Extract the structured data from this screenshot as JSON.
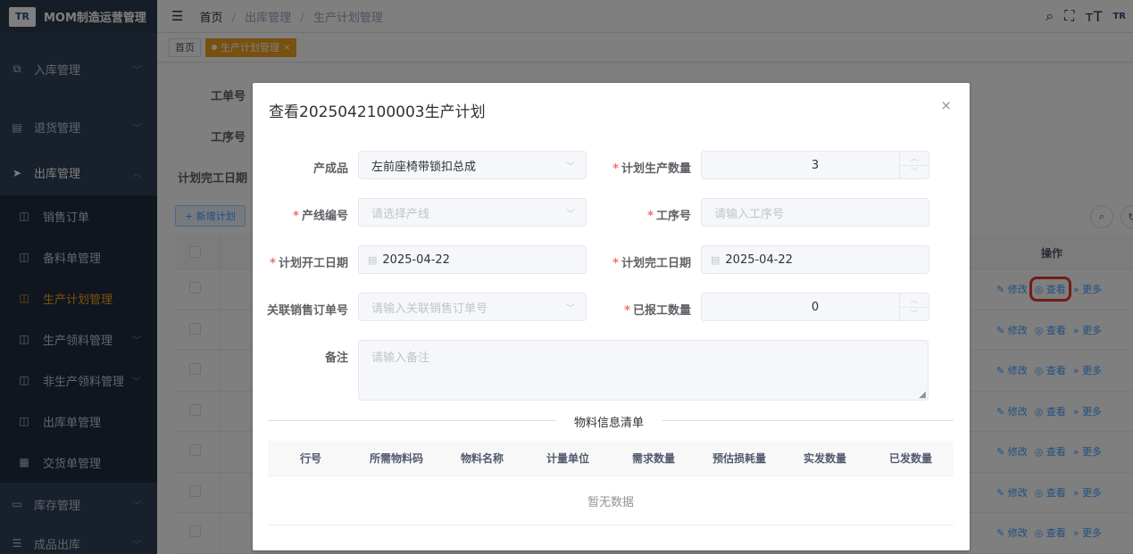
{
  "app": {
    "title": "MOM制造运营管理",
    "logo_text": "TR"
  },
  "sidebar": {
    "items": [
      {
        "label": "入库管理",
        "icon": "external-link-icon"
      },
      {
        "label": "退货管理",
        "icon": "document-icon"
      },
      {
        "label": "出库管理",
        "icon": "send-icon"
      }
    ],
    "sub_items": [
      {
        "label": "销售订单"
      },
      {
        "label": "备料单管理"
      },
      {
        "label": "生产计划管理"
      },
      {
        "label": "生产领料管理"
      },
      {
        "label": "非生产领料管理"
      },
      {
        "label": "出库单管理"
      },
      {
        "label": "交货单管理"
      }
    ],
    "bottom_items": [
      {
        "label": "库存管理"
      },
      {
        "label": "成品出库"
      }
    ]
  },
  "breadcrumb": {
    "home": "首页",
    "level1": "出库管理",
    "level2": "生产计划管理",
    "sep": "/"
  },
  "tags": {
    "home": "首页",
    "active": "生产计划管理",
    "close": "×"
  },
  "page": {
    "filter_labels": {
      "order_no": "工单号",
      "process_no": "工序号",
      "plan_end": "计划完工日期"
    },
    "add_button": "+ 新增计划",
    "table": {
      "op_header": "操作",
      "actions": {
        "edit": "修改",
        "view": "查看",
        "more": "更多"
      },
      "row_count": 7
    }
  },
  "modal": {
    "title": "查看2025042100003生产计划",
    "close": "×",
    "fields": {
      "product": {
        "label": "产成品",
        "value": "左前座椅带锁扣总成"
      },
      "plan_qty": {
        "label": "计划生产数量",
        "value": "3"
      },
      "line_no": {
        "label": "产线编号",
        "placeholder": "请选择产线"
      },
      "process_no": {
        "label": "工序号",
        "placeholder": "请输入工序号"
      },
      "plan_start": {
        "label": "计划开工日期",
        "value": "2025-04-22"
      },
      "plan_end": {
        "label": "计划完工日期",
        "value": "2025-04-22"
      },
      "sales_order": {
        "label": "关联销售订单号",
        "placeholder": "请输入关联销售订单号"
      },
      "reported_qty": {
        "label": "已报工数量",
        "value": "0"
      },
      "remark": {
        "label": "备注",
        "placeholder": "请输入备注"
      }
    },
    "material_section": "物料信息清单",
    "material_columns": [
      "行号",
      "所需物料码",
      "物料名称",
      "计量单位",
      "需求数量",
      "预估损耗量",
      "实发数量",
      "已发数量"
    ],
    "empty_text": "暂无数据"
  }
}
